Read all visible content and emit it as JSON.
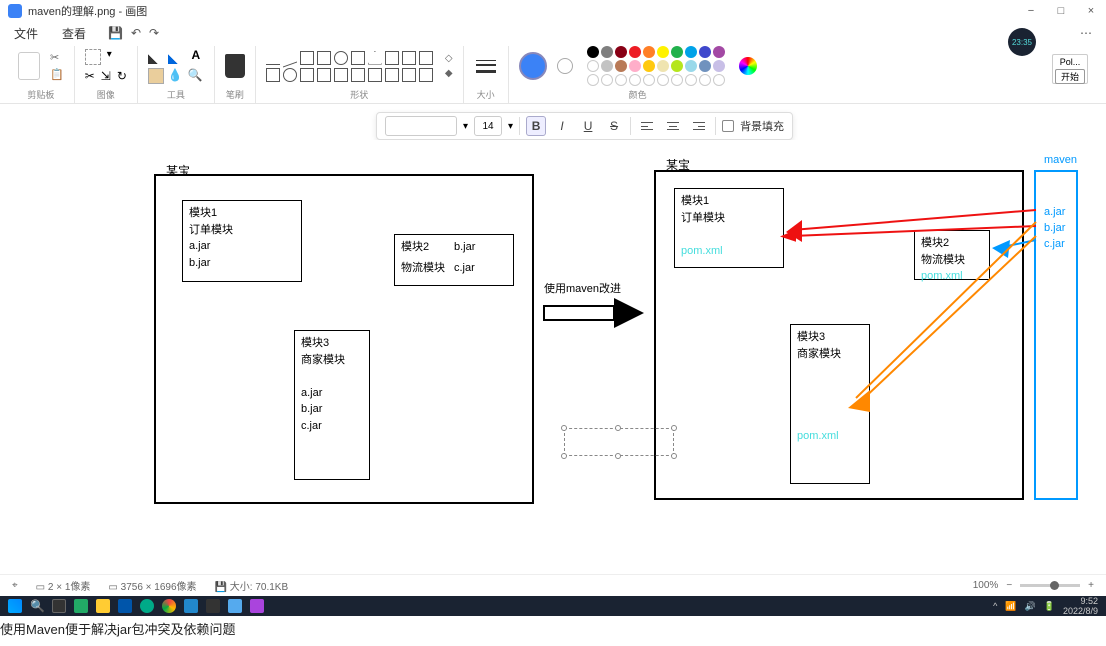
{
  "titlebar": {
    "filename": "maven的理解.png",
    "appname": "画图",
    "min": "−",
    "max": "□",
    "close": "×"
  },
  "menubar": {
    "file": "文件",
    "view": "查看",
    "save_icon": "💾",
    "undo": "↶",
    "redo": "↷",
    "overflow": "⋯"
  },
  "time_badge": "23:35",
  "ribbon": {
    "clipboard": {
      "label": "剪贴板"
    },
    "image": {
      "label": "图像"
    },
    "tools": {
      "label": "工具"
    },
    "brushes": {
      "label": "笔刷"
    },
    "shapes": {
      "label": "形状"
    },
    "size": {
      "label": "大小"
    },
    "colors": {
      "label": "颜色"
    }
  },
  "right_box": {
    "line1": "Pol...",
    "btn": "开始"
  },
  "text_toolbar": {
    "font_size": "14",
    "bold": "B",
    "italic": "I",
    "underline": "U",
    "strike": "S",
    "bgfill_label": "背景填充"
  },
  "diagram": {
    "left_title": "某宝",
    "right_title": "某宝",
    "maven_box_label": "maven",
    "mod1_title": "模块1",
    "mod1_sub": "订单模块",
    "mod1_a": "a.jar",
    "mod1_b": "b.jar",
    "mod2_title": "模块2",
    "mod2_sub": "物流模块",
    "mod2_b": "b.jar",
    "mod2_c": "c.jar",
    "mod3_title": "模块3",
    "mod3_sub": "商家模块",
    "mod3_a": "a.jar",
    "mod3_b": "b.jar",
    "mod3_c": "c.jar",
    "arrow_label": "使用maven改进",
    "r_mod1_title": "模块1",
    "r_mod1_sub": "订单模块",
    "r_mod2_title": "模块2",
    "r_mod2_sub": "物流模块",
    "r_mod3_title": "模块3",
    "r_mod3_sub": "商家模块",
    "pom": "pom.xml",
    "jar_a": "a.jar",
    "jar_b": "b.jar",
    "jar_c": "c.jar"
  },
  "statusbar": {
    "cursor_icon": "⌖",
    "sel": "2 × 1像素",
    "dims": "3756 × 1696像素",
    "disk": "大小: 70.1KB",
    "zoom": "100%",
    "zoom_out": "−",
    "zoom_in": "+"
  },
  "taskbar": {
    "time": "9:52",
    "date": "2022/8/9"
  },
  "caption": "使用Maven便于解决jar包冲突及依赖问题",
  "palette_colors": [
    "#000",
    "#7f7f7f",
    "#880015",
    "#ed1c24",
    "#ff7f27",
    "#fff200",
    "#22b14c",
    "#00a2e8",
    "#3f48cc",
    "#a349a4",
    "#fff",
    "#c3c3c3",
    "#b97a57",
    "#ffaec9",
    "#ffc90e",
    "#efe4b0",
    "#b5e61d",
    "#99d9ea",
    "#7092be",
    "#c8bfe7",
    "#fff",
    "#fff",
    "#fff",
    "#fff",
    "#fff",
    "#fff",
    "#fff",
    "#fff",
    "#fff",
    "#fff"
  ]
}
